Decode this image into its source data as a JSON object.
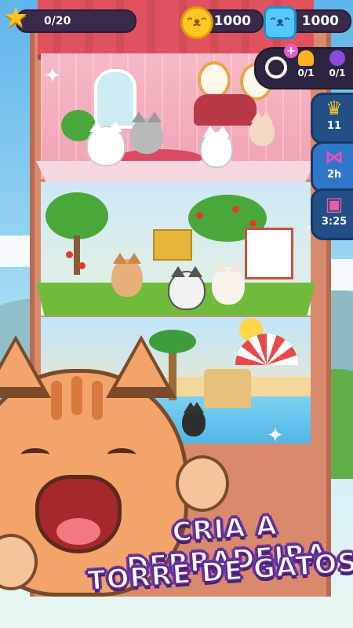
{
  "hud": {
    "stars": {
      "label": "0/20",
      "progress": 0.0,
      "icon": "star-icon"
    },
    "coins": {
      "value": "1000",
      "icon": "cat-coin-icon"
    },
    "gems": {
      "value": "1000",
      "icon": "cat-gem-icon"
    }
  },
  "resources": {
    "bell": {
      "label": "0/1",
      "icon": "bell-icon"
    },
    "orb": {
      "label": "0/1",
      "icon": "orb-icon"
    }
  },
  "side_buttons": {
    "crown": {
      "label": "11",
      "icon": "crown-icon"
    },
    "bow": {
      "label": "2h",
      "icon": "bow-icon"
    },
    "gift": {
      "label": "3:25",
      "icon": "gift-icon"
    }
  },
  "tagline": {
    "line1": "CRIA A DERRADEIRA",
    "line2": "TORRE DE GATOS!"
  },
  "colors": {
    "accent_purple": "#6d36a8",
    "roof_red": "#e0525e",
    "hud_dark": "#3a2a4a",
    "gold": "#ffc726",
    "gem_blue": "#55c8ff"
  }
}
